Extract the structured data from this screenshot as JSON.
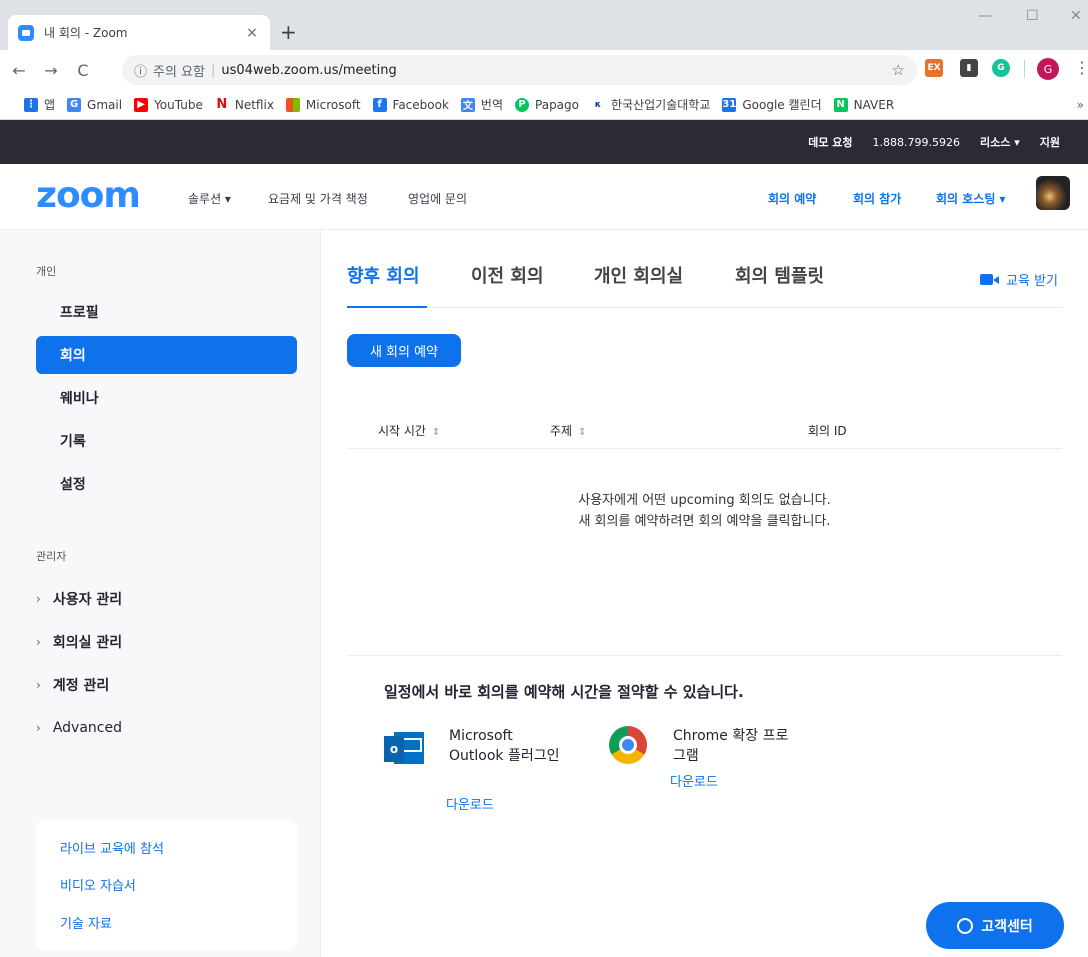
{
  "browser": {
    "tab_title": "내 회의 - Zoom",
    "new_tab": "+",
    "close_tab": "×",
    "window_controls": [
      "—",
      "☐",
      "✕"
    ],
    "security_label": "주의 요함",
    "url": "us04web.zoom.us/meeting",
    "profile_initial": "G",
    "bookmarks": [
      {
        "label": "앱",
        "color": "#1a73e8"
      },
      {
        "label": "Gmail",
        "color": "#4285f4"
      },
      {
        "label": "YouTube",
        "color": "#ff0000"
      },
      {
        "label": "Netflix",
        "color": "#e50914"
      },
      {
        "label": "Microsoft",
        "color": "#f25022"
      },
      {
        "label": "Facebook",
        "color": "#1877f2"
      },
      {
        "label": "번역",
        "color": "#4285f4"
      },
      {
        "label": "Papago",
        "color": "#03c75a"
      },
      {
        "label": "한국산업기술대학교",
        "color": "#1e40af"
      },
      {
        "label": "Google 캘린더",
        "color": "#1a73e8"
      },
      {
        "label": "NAVER",
        "color": "#03c75a"
      }
    ],
    "more": "»"
  },
  "topbar": {
    "demo": "데모 요청",
    "phone": "1.888.799.5926",
    "resources": "리소스 ▾",
    "support": "지원"
  },
  "header": {
    "logo": "zoom",
    "nav_left": [
      "솔루션 ▾",
      "요금제 및 가격 책정",
      "영업에 문의"
    ],
    "nav_right": [
      "회의 예약",
      "회의 참가",
      "회의 호스팅 ▾"
    ]
  },
  "sidebar": {
    "personal_heading": "개인",
    "items": [
      "프로필",
      "회의",
      "웨비나",
      "기록",
      "설정"
    ],
    "active_index": 1,
    "admin_heading": "관리자",
    "admin_items": [
      "사용자 관리",
      "회의실 관리",
      "계정 관리",
      "Advanced"
    ],
    "links": [
      "라이브 교육에 참석",
      "비디오 자습서",
      "기술 자료"
    ]
  },
  "main": {
    "tabs": [
      "향후 회의",
      "이전 회의",
      "개인 회의실",
      "회의 템플릿"
    ],
    "active_tab": 0,
    "training": "교육 받기",
    "new_meeting_button": "새 회의 예약",
    "columns": [
      "시작 시간",
      "주제",
      "회의 ID"
    ],
    "sort_glyph": "⇕",
    "empty_line1": "사용자에게 어떤 upcoming 회의도 없습니다.",
    "empty_line2": "새 회의를 예약하려면 회의 예약을 클릭합니다.",
    "promo_title": "일정에서 바로 회의를 예약해 시간을 절약할 수 있습니다.",
    "plugins": [
      {
        "name": "Microsoft Outlook 플러그인",
        "download": "다운로드"
      },
      {
        "name": "Chrome 확장 프로그램",
        "download": "다운로드"
      }
    ],
    "help_button": "고객센터"
  },
  "colors": {
    "brand": "#0e72ed",
    "logo": "#2d8cff",
    "topbar": "#2b2b35"
  }
}
